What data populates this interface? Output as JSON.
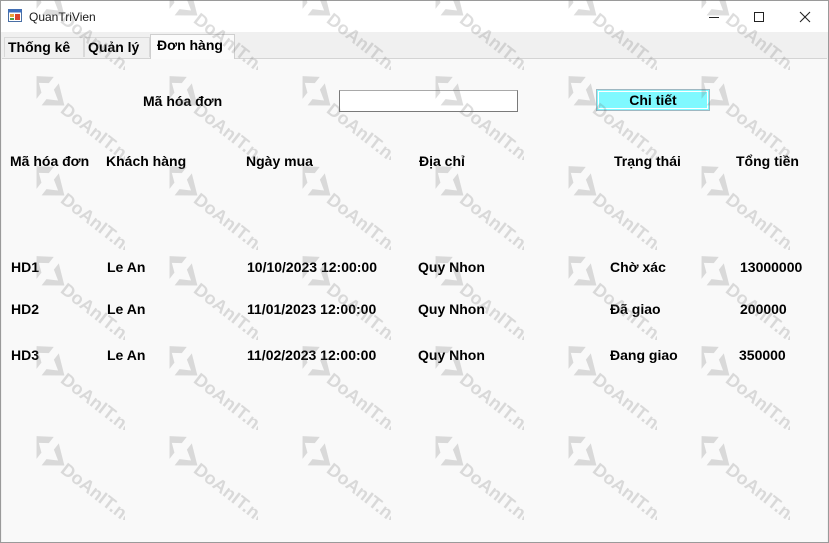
{
  "window": {
    "title": "QuanTriVien"
  },
  "tabs": [
    {
      "label": "Thống kê"
    },
    {
      "label": "Quản lý"
    },
    {
      "label": "Đơn hàng",
      "selected": true
    }
  ],
  "search": {
    "label": "Mã hóa đơn",
    "value": "",
    "button_label": "Chi tiết",
    "button_color": "#7ff9ff"
  },
  "table": {
    "columns": [
      "Mã hóa đơn",
      "Khách hàng",
      "Ngày mua",
      "Địa chỉ",
      "Trạng thái",
      "Tổng tiền"
    ],
    "rows": [
      [
        "HD1",
        "Le An",
        "10/10/2023 12:00:00",
        "Quy Nhon",
        "Chờ xác",
        "13000000"
      ],
      [
        "HD2",
        "Le An",
        "11/01/2023 12:00:00",
        "Quy Nhon",
        "Đã giao",
        "200000"
      ],
      [
        "HD3",
        "Le An",
        "11/02/2023 12:00:00",
        "Quy Nhon",
        "Đang giao",
        "350000"
      ]
    ]
  },
  "watermark": {
    "text": "DoAnIT.net",
    "icon": "doanit-logo-icon"
  }
}
